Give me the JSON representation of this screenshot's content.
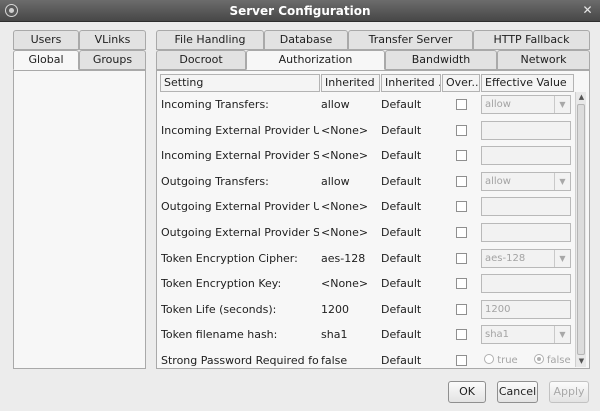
{
  "window": {
    "title": "Server Configuration",
    "close_glyph": "✕"
  },
  "left_tabs": [
    {
      "label": "Users"
    },
    {
      "label": "VLinks"
    },
    {
      "label": "Global"
    },
    {
      "label": "Groups"
    }
  ],
  "right_tabs": [
    {
      "label": "File Handling"
    },
    {
      "label": "Database"
    },
    {
      "label": "Transfer Server"
    },
    {
      "label": "HTTP Fallback"
    },
    {
      "label": "Docroot"
    },
    {
      "label": "Authorization"
    },
    {
      "label": "Bandwidth"
    },
    {
      "label": "Network"
    }
  ],
  "table": {
    "headers": [
      {
        "label": "Setting"
      },
      {
        "label": "Inherited ..."
      },
      {
        "label": "Inherited ..."
      },
      {
        "label": "Over..."
      },
      {
        "label": "Effective Value"
      }
    ],
    "rows": [
      {
        "setting": "Incoming Transfers:",
        "inherited_value": "allow",
        "inherited_from": "Default",
        "effective": "allow",
        "control": "combo"
      },
      {
        "setting": "Incoming External Provider URL:",
        "inherited_value": "<None>",
        "inherited_from": "Default",
        "effective": "",
        "control": "text"
      },
      {
        "setting": "Incoming External Provider SO...",
        "inherited_value": "<None>",
        "inherited_from": "Default",
        "effective": "",
        "control": "text"
      },
      {
        "setting": "Outgoing Transfers:",
        "inherited_value": "allow",
        "inherited_from": "Default",
        "effective": "allow",
        "control": "combo"
      },
      {
        "setting": "Outgoing External Provider URL:",
        "inherited_value": "<None>",
        "inherited_from": "Default",
        "effective": "",
        "control": "text"
      },
      {
        "setting": "Outgoing External Provider SO...",
        "inherited_value": "<None>",
        "inherited_from": "Default",
        "effective": "",
        "control": "text"
      },
      {
        "setting": "Token Encryption Cipher:",
        "inherited_value": "aes-128",
        "inherited_from": "Default",
        "effective": "aes-128",
        "control": "combo"
      },
      {
        "setting": "Token Encryption Key:",
        "inherited_value": "<None>",
        "inherited_from": "Default",
        "effective": "",
        "control": "text"
      },
      {
        "setting": "Token Life (seconds):",
        "inherited_value": "1200",
        "inherited_from": "Default",
        "effective": "1200",
        "control": "text"
      },
      {
        "setting": "Token filename hash:",
        "inherited_value": "sha1",
        "inherited_from": "Default",
        "effective": "sha1",
        "control": "combo"
      },
      {
        "setting": "Strong Password Required for ...",
        "inherited_value": "false",
        "inherited_from": "Default",
        "effective": "",
        "control": "radio",
        "radio_true": "true",
        "radio_false": "false"
      }
    ]
  },
  "buttons": {
    "ok": "OK",
    "cancel": "Cancel",
    "apply": "Apply"
  },
  "icons": {
    "scroll_up": "▲",
    "scroll_down": "▼",
    "combo_arrow": "▼"
  }
}
